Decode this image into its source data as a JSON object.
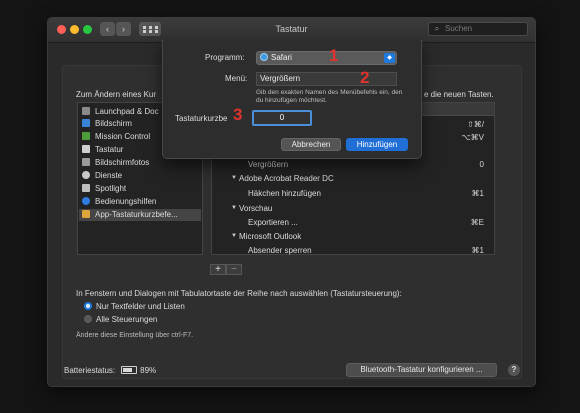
{
  "window": {
    "title": "Tastatur"
  },
  "search": {
    "placeholder": "Suchen"
  },
  "hints": {
    "left": "Zum Ändern eines Kur",
    "right": "e die neuen Tasten."
  },
  "sidebar": {
    "items": [
      {
        "label": "Launchpad & Doc",
        "color": "#8a8a8a"
      },
      {
        "label": "Bildschirm",
        "color": "#3a84d8"
      },
      {
        "label": "Mission Control",
        "color": "#4f9d3a"
      },
      {
        "label": "Tastatur",
        "color": "#cfcfcf"
      },
      {
        "label": "Bildschirmfotos",
        "color": "#9a9a9a"
      },
      {
        "label": "Dienste",
        "color": "#c8c8c8"
      },
      {
        "label": "Spotlight",
        "color": "#bfbfbf"
      },
      {
        "label": "Bedienungshilfen",
        "color": "#2f7be0"
      },
      {
        "label": "App-Tastaturkurzbefe...",
        "color": "#e0a53a"
      }
    ]
  },
  "table": {
    "rows": [
      {
        "label": "",
        "shortcut": "⇧⌘/"
      },
      {
        "label": "",
        "shortcut": "⌥⌘V"
      },
      {
        "label": "Vergrößern",
        "shortcut": "0"
      },
      {
        "label": "Adobe Acrobat Reader DC",
        "shortcut": ""
      },
      {
        "label": "Häkchen hinzufügen",
        "shortcut": "⌘1"
      },
      {
        "label": "Vorschau",
        "shortcut": ""
      },
      {
        "label": "Exportieren ...",
        "shortcut": "⌘E"
      },
      {
        "label": "Microsoft Outlook",
        "shortcut": ""
      },
      {
        "label": "Absender sperren",
        "shortcut": "⌘1"
      }
    ],
    "add_label": "+",
    "remove_label": "−"
  },
  "keyboard_nav": {
    "description": "In Fenstern und Dialogen mit Tabulatortaste der Reihe nach auswählen (Tastatursteuerung):",
    "option1": "Nur Textfelder und Listen",
    "option2": "Alle Steuerungen",
    "note": "Ändere diese Einstellung über ctrl-F7."
  },
  "battery": {
    "label": "Batteriestatus:",
    "value": "89%"
  },
  "bluetooth_button": "Bluetooth-Tastatur konfigurieren ...",
  "help_label": "?",
  "sheet": {
    "program_label": "Programm:",
    "program_value": "Safari",
    "menu_label": "Menü:",
    "menu_value": "Vergrößern",
    "menu_help": "Gib den exakten Namen des Menübefehls ein, den du hinzufügen möchtest.",
    "shortcut_label": "Tastaturkurzbe",
    "shortcut_value": "0",
    "cancel": "Abbrechen",
    "add": "Hinzufügen"
  },
  "badges": [
    "1",
    "2",
    "3"
  ],
  "colors": {
    "accent": "#1f7ae0",
    "badge": "#e0332e"
  }
}
